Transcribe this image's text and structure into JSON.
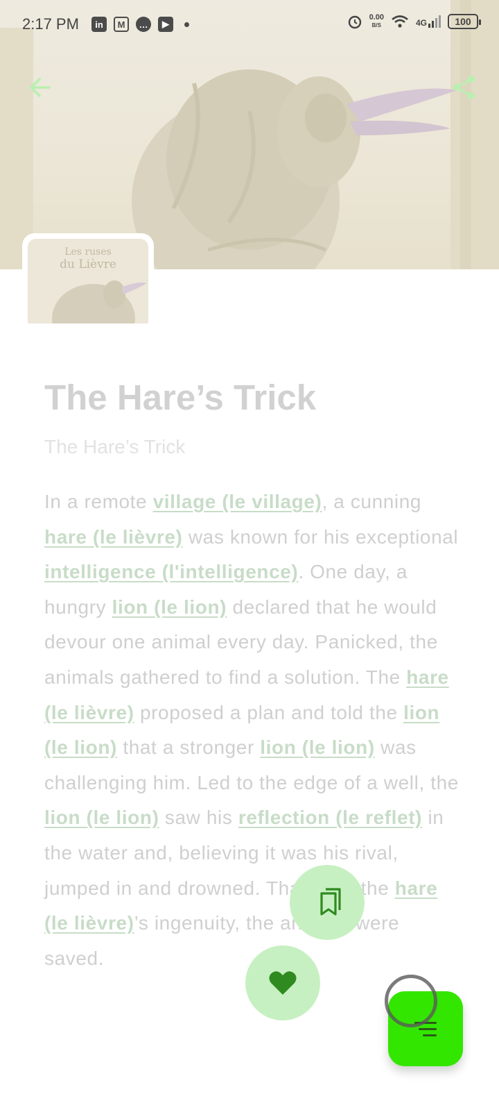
{
  "status_bar": {
    "time": "2:17 PM",
    "apps": [
      "linkedin-icon",
      "gmail-icon",
      "messages-icon",
      "youtube-icon"
    ],
    "net_speed_value": "0.00",
    "net_speed_unit": "B/S",
    "network": "4G",
    "battery": "100"
  },
  "header": {
    "back_icon": "arrow-left-icon",
    "share_icon": "share-icon",
    "accent_color": "#b9f0b0"
  },
  "cover": {
    "title_line1": "Les ruses",
    "title_line2": "du Lièvre"
  },
  "story": {
    "title": "The Hare’s Trick",
    "subtitle": "The Hare’s Trick",
    "body": [
      {
        "t": "In a remote "
      },
      {
        "t": "village (le village)",
        "v": true
      },
      {
        "t": ", a cunning "
      },
      {
        "t": "hare (le lièvre)",
        "v": true
      },
      {
        "t": " was known for his exceptional "
      },
      {
        "t": "intelligence (l'intelligence)",
        "v": true
      },
      {
        "t": ". One day, a hungry "
      },
      {
        "t": "lion (le lion)",
        "v": true
      },
      {
        "t": " declared that he would devour one animal every day. Panicked, the animals gathered to find a solution. The "
      },
      {
        "t": "hare (le lièvre)",
        "v": true
      },
      {
        "t": " proposed a plan and told the "
      },
      {
        "t": "lion (le lion)",
        "v": true
      },
      {
        "t": " that a stronger "
      },
      {
        "t": "lion (le lion)",
        "v": true
      },
      {
        "t": " was challenging him. Led to the edge of a well, the "
      },
      {
        "t": "lion (le lion)",
        "v": true
      },
      {
        "t": " saw his "
      },
      {
        "t": "reflection (le reflet)",
        "v": true
      },
      {
        "t": " in the water and, believing it was his rival, jumped in and drowned. Thanks to the "
      },
      {
        "t": "hare (le lièvre)",
        "v": true
      },
      {
        "t": "’s ingenuity, the animals were saved."
      }
    ]
  },
  "fabs": {
    "bookmark_icon": "bookmarks-icon",
    "like_icon": "heart-icon",
    "menu_icon": "menu-lines-icon",
    "menu_color": "#33e600",
    "fab_color": "#c7f0c2"
  }
}
